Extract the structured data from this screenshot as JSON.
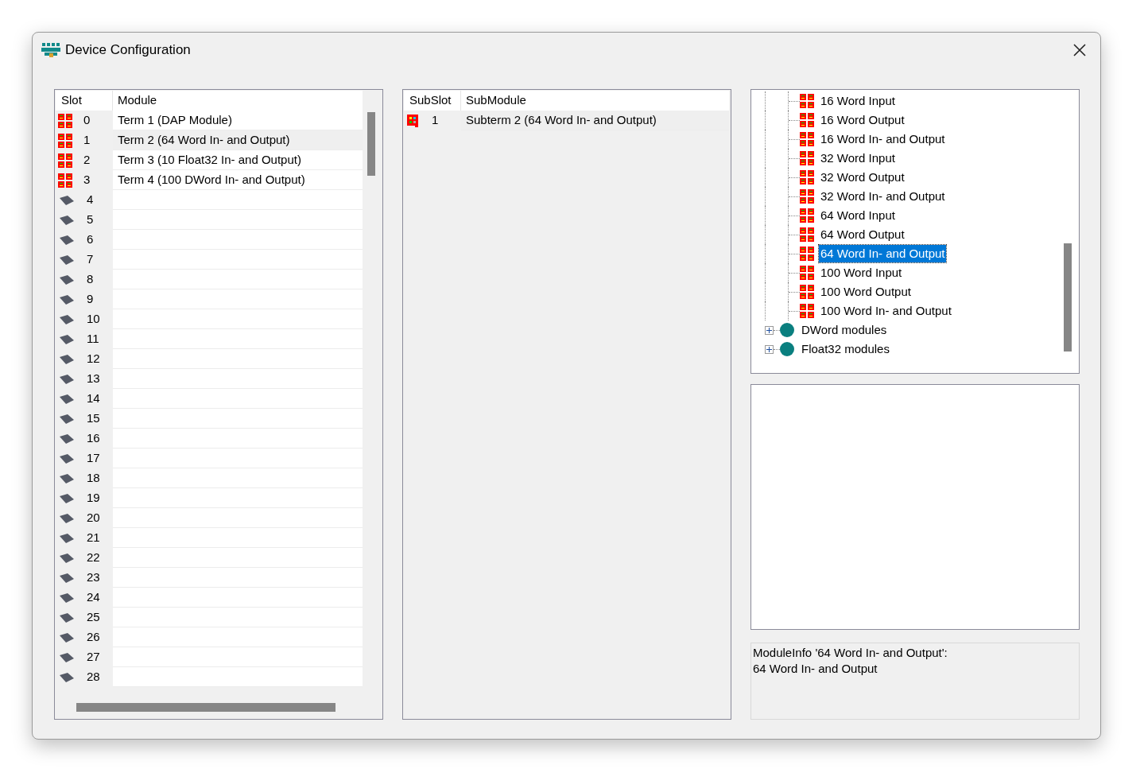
{
  "window": {
    "title": "Device Configuration"
  },
  "slots": {
    "columns": [
      "Slot",
      "Module"
    ],
    "rows": [
      {
        "kind": "module",
        "slot": "0",
        "module": "Term 1 (DAP Module)",
        "selected": false
      },
      {
        "kind": "module",
        "slot": "1",
        "module": "Term 2 (64 Word In- and Output)",
        "selected": true
      },
      {
        "kind": "module",
        "slot": "2",
        "module": "Term 3 (10 Float32 In- and Output)",
        "selected": false
      },
      {
        "kind": "module",
        "slot": "3",
        "module": "Term 4 (100 DWord In- and Output)",
        "selected": false
      },
      {
        "kind": "empty",
        "slot": "4",
        "selected": false
      },
      {
        "kind": "empty",
        "slot": "5",
        "selected": false
      },
      {
        "kind": "empty",
        "slot": "6",
        "selected": false
      },
      {
        "kind": "empty",
        "slot": "7",
        "selected": false
      },
      {
        "kind": "empty",
        "slot": "8",
        "selected": false
      },
      {
        "kind": "empty",
        "slot": "9",
        "selected": false
      },
      {
        "kind": "empty",
        "slot": "10",
        "selected": false
      },
      {
        "kind": "empty",
        "slot": "11",
        "selected": false
      },
      {
        "kind": "empty",
        "slot": "12",
        "selected": false
      },
      {
        "kind": "empty",
        "slot": "13",
        "selected": false
      },
      {
        "kind": "empty",
        "slot": "14",
        "selected": false
      },
      {
        "kind": "empty",
        "slot": "15",
        "selected": false
      },
      {
        "kind": "empty",
        "slot": "16",
        "selected": false
      },
      {
        "kind": "empty",
        "slot": "17",
        "selected": false
      },
      {
        "kind": "empty",
        "slot": "18",
        "selected": false
      },
      {
        "kind": "empty",
        "slot": "19",
        "selected": false
      },
      {
        "kind": "empty",
        "slot": "20",
        "selected": false
      },
      {
        "kind": "empty",
        "slot": "21",
        "selected": false
      },
      {
        "kind": "empty",
        "slot": "22",
        "selected": false
      },
      {
        "kind": "empty",
        "slot": "23",
        "selected": false
      },
      {
        "kind": "empty",
        "slot": "24",
        "selected": false
      },
      {
        "kind": "empty",
        "slot": "25",
        "selected": false
      },
      {
        "kind": "empty",
        "slot": "26",
        "selected": false
      },
      {
        "kind": "empty",
        "slot": "27",
        "selected": false
      },
      {
        "kind": "empty",
        "slot": "28",
        "selected": false
      }
    ]
  },
  "subslots": {
    "columns": [
      "SubSlot",
      "SubModule"
    ],
    "rows": [
      {
        "kind": "submodule",
        "slot": "1",
        "module": "Subterm 2 (64 Word In- and Output)",
        "selected": true
      }
    ]
  },
  "catalog": {
    "items": [
      {
        "children": [
          {
            "kind": "module",
            "label": "16 Word Input",
            "selected": false
          },
          {
            "kind": "module",
            "label": "16 Word Output",
            "selected": false
          },
          {
            "kind": "module",
            "label": "16 Word In- and Output",
            "selected": false
          },
          {
            "kind": "module",
            "label": "32 Word Input",
            "selected": false
          },
          {
            "kind": "module",
            "label": "32 Word Output",
            "selected": false
          },
          {
            "kind": "module",
            "label": "32 Word In- and Output",
            "selected": false
          },
          {
            "kind": "module",
            "label": "64 Word Input",
            "selected": false
          },
          {
            "kind": "module",
            "label": "64 Word Output",
            "selected": false
          },
          {
            "kind": "module",
            "label": "64 Word In- and Output",
            "selected": true
          },
          {
            "kind": "module",
            "label": "100 Word Input",
            "selected": false
          },
          {
            "kind": "module",
            "label": "100 Word Output",
            "selected": false
          },
          {
            "kind": "module",
            "label": "100 Word In- and Output",
            "selected": false
          }
        ]
      },
      {
        "kind": "group",
        "label": "DWord modules",
        "expanded": false,
        "selected": false
      },
      {
        "kind": "group",
        "label": "Float32 modules",
        "expanded": false,
        "selected": false
      }
    ]
  },
  "module_info": [
    "ModuleInfo '64 Word In- and Output':",
    "64 Word In- and Output"
  ]
}
